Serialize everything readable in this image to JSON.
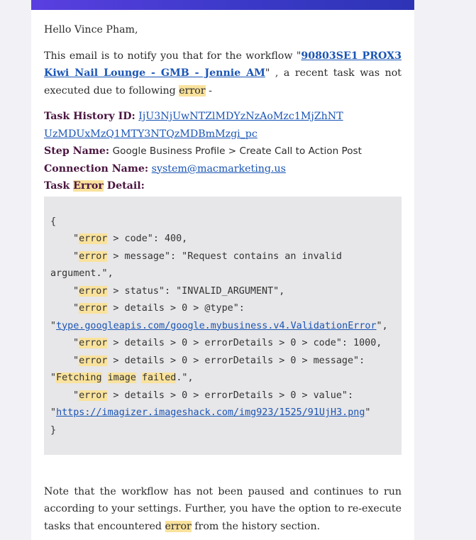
{
  "colors": {
    "header_start": "#5a3fe0",
    "header_end": "#2e34b6",
    "link": "#1a55b5",
    "highlight": "#f9e29c",
    "code_bg": "#e7e6e8",
    "label": "#4a1540"
  },
  "greeting": "Hello Vince Pham,",
  "intro": {
    "before": "This email is to notify you that for the workflow \"",
    "workflow_link": "90803SE1 PROX3 Kiwi Nail Lounge - GMB - Jennie AM",
    "middle": "\" , a recent task was not executed due to following ",
    "error_word": "error",
    "after": " -"
  },
  "task_history": {
    "label": "Task History ID:",
    "value": "IjU3NjUwNTZlMDYzNzAoMzc1MjZhNT UzMDUxMzQ1MTY3NTQzMDBmMzgi_pc"
  },
  "step_name": {
    "label": "Step Name:",
    "value": "Google Business Profile > Create Call to Action Post"
  },
  "connection_name": {
    "label": "Connection Name:",
    "value": "system@macmarketing.us"
  },
  "task_error_detail": {
    "label_before": "Task ",
    "label_hl": "Error",
    "label_after": " Detail:"
  },
  "code": {
    "open": "{",
    "close": "}",
    "err": "error",
    "l1_rest": " > code\": 400,",
    "l2_rest": " > message\": \"Request contains an invalid",
    "l2_cont": "argument.\",",
    "l3_rest": " > status\": \"INVALID_ARGUMENT\",",
    "l4_rest": " > details > 0 > @type\":",
    "l4_link": "type.googleapis.com/google.mybusiness.v4.ValidationError",
    "l4_tail": "\",",
    "l5_rest": " > details > 0 > errorDetails > 0 > code\": 1000,",
    "l6_rest": " > details > 0 > errorDetails > 0 > message\":",
    "l6_w1": "Fetching",
    "l6_w2": "image",
    "l6_w3": "failed",
    "l6_tail": ".\",",
    "l7_rest": " > details > 0 > errorDetails > 0 > value\":",
    "l7_link": "https://imagizer.imageshack.com/img923/1525/91UjH3.png",
    "l7_tail": "\""
  },
  "note": {
    "before": "Note that the workflow has not been paused and continues to run according to your settings. Further, you have the option to re-execute tasks that encountered ",
    "error_word": "error",
    "after": " from the history section."
  }
}
